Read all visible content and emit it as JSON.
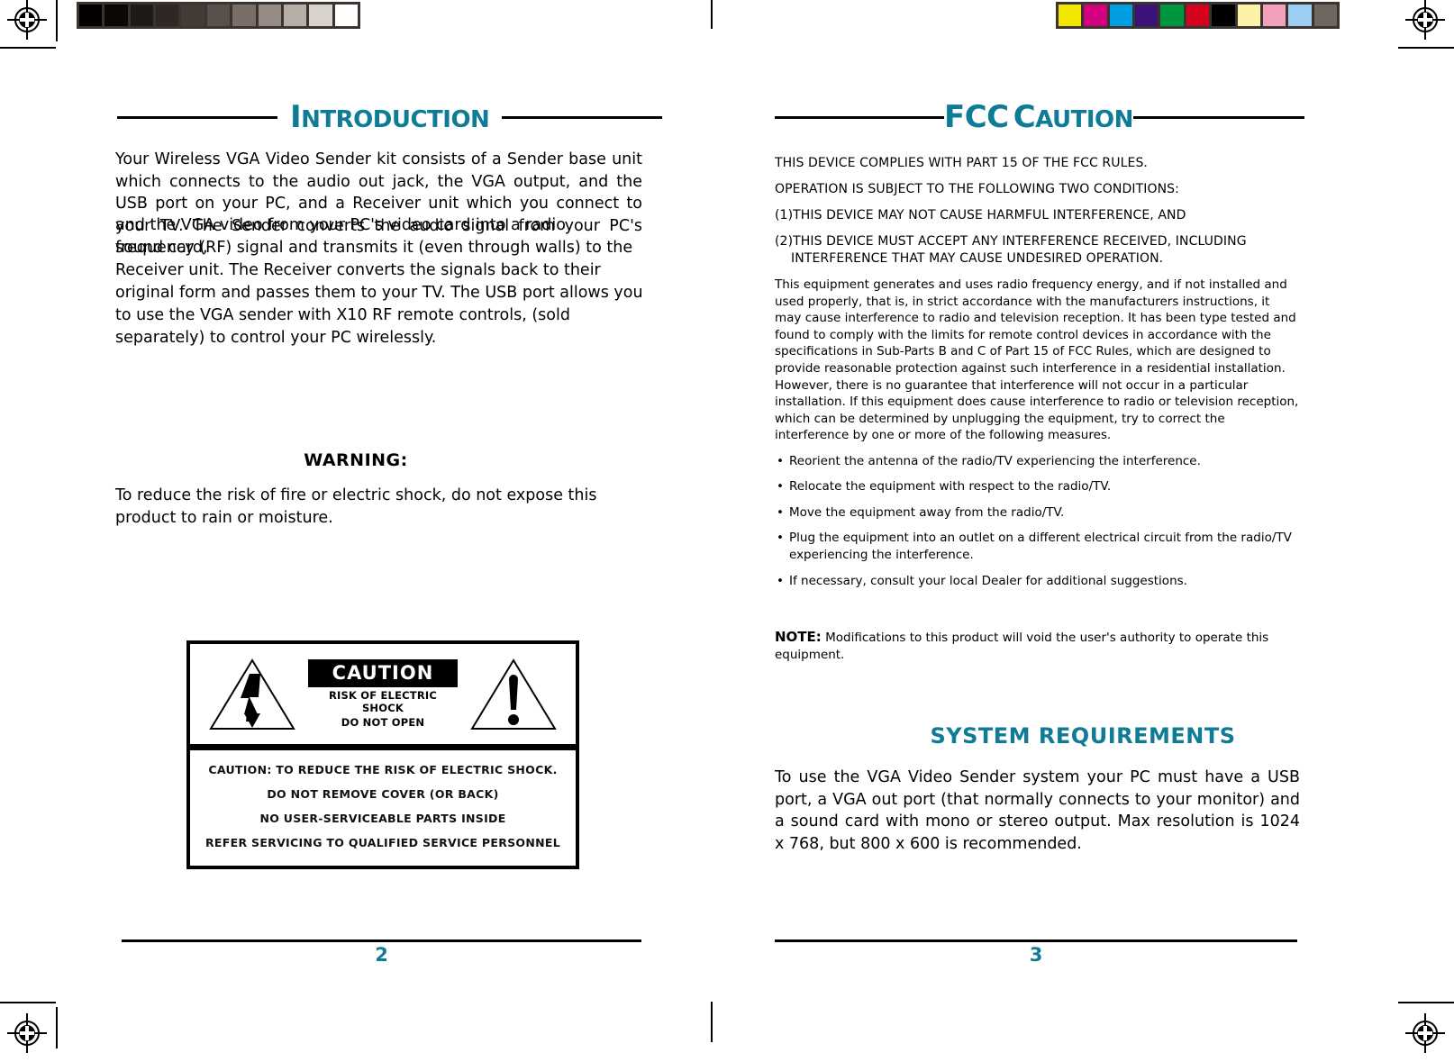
{
  "document": {
    "type": "printed-manual-spread",
    "accent_color": "#0e7c96",
    "text_color": "#000000"
  },
  "calibration": {
    "grayscale_swatches": [
      "#030000",
      "#0b0707",
      "#1d1a19",
      "#2e2724",
      "#443b36",
      "#5a504b",
      "#7a6e68",
      "#978b86",
      "#b8aea8",
      "#d7d2cc",
      "#ffffff"
    ],
    "color_swatches": [
      "#f2e500",
      "#d4007e",
      "#009ee2",
      "#3b1277",
      "#009640",
      "#d4021d",
      "#000000",
      "#fbf2a8",
      "#f2a0bb",
      "#9bcef2",
      "#6e665f"
    ]
  },
  "left_page": {
    "heading": {
      "first_letter": "I",
      "rest": "NTRODUCTION"
    },
    "intro_paragraph": "Your Wireless VGA Video Sender kit consists of a Sender base unit which connects to the audio out jack, the VGA output, and the USB port on your PC, and a Receiver unit which you connect to your TV. The Sender converts the audio signal from your PC's sound card,",
    "intro_paragraph_2": "and the VGA video from your PC's video card into a radio frequency (RF) signal and transmits it (even through walls) to the Receiver unit. The Receiver converts the signals back to their original form and passes them to your TV. The USB port allows you to use the VGA sender with X10 RF remote controls, (sold separately) to control your PC wirelessly.",
    "warning_title": "WARNING:",
    "warning_text": "To reduce the risk of fire or electric shock, do not expose this product to rain or moisture.",
    "caution_graphic": {
      "panel_title": "CAUTION",
      "panel_sub_line1": "RISK OF ELECTRIC SHOCK",
      "panel_sub_line2": "DO NOT OPEN",
      "left_symbol": "lightning-bolt-triangle",
      "right_symbol": "exclamation-triangle",
      "bottom_lines": [
        "CAUTION: TO REDUCE THE RISK OF ELECTRIC SHOCK.",
        "DO NOT REMOVE COVER (OR BACK)",
        "NO USER-SERVICEABLE PARTS INSIDE",
        "REFER SERVICING TO QUALIFIED SERVICE PERSONNEL"
      ]
    },
    "page_number": "2"
  },
  "right_page": {
    "heading": {
      "part1_cap": "FCC",
      "part2_first": "C",
      "part2_rest": "AUTION"
    },
    "fcc_statements": [
      "THIS DEVICE COMPLIES WITH PART 15 OF THE FCC RULES.",
      "OPERATION IS SUBJECT TO THE FOLLOWING TWO CONDITIONS:",
      "(1)THIS DEVICE MAY NOT CAUSE HARMFUL INTERFERENCE, AND",
      "(2)THIS DEVICE MUST ACCEPT ANY INTERFERENCE RECEIVED, INCLUDING",
      "INTERFERENCE THAT MAY CAUSE UNDESIRED OPERATION."
    ],
    "fcc_paragraph": "This equipment generates and uses radio frequency energy, and if not installed and used properly, that is, in strict accordance with the manufacturers instructions, it may cause interference to radio and television reception. It has been type tested and found to comply with the limits for remote control devices in accordance with the specifications in Sub-Parts B and C of Part 15 of FCC Rules, which are designed to provide reasonable protection against such interference in a residential installation. However, there is no guarantee that interference will not occur in a particular installation. If this equipment does cause interference to radio or television reception, which can be determined by unplugging the equipment, try to correct the interference by one or more of the following measures.",
    "bullets": [
      "Reorient the antenna of the radio/TV experiencing the interference.",
      "Relocate the equipment with respect to the radio/TV.",
      "Move the equipment away from the radio/TV.",
      "Plug the equipment into an outlet on a different electrical circuit from the radio/TV experiencing the interference.",
      "If necessary, consult your local Dealer for additional suggestions."
    ],
    "note_label": "NOTE:",
    "note_text": "Modifications to this product will void the user's authority to operate this equipment.",
    "system_requirements_title": "SYSTEM REQUIREMENTS",
    "system_requirements_text": "To use the VGA Video Sender system your PC must have a USB port, a VGA out port (that normally connects to your monitor) and a sound card with mono or stereo output. Max resolution is 1024 x 768, but 800 x 600 is recommended.",
    "page_number": "3"
  }
}
